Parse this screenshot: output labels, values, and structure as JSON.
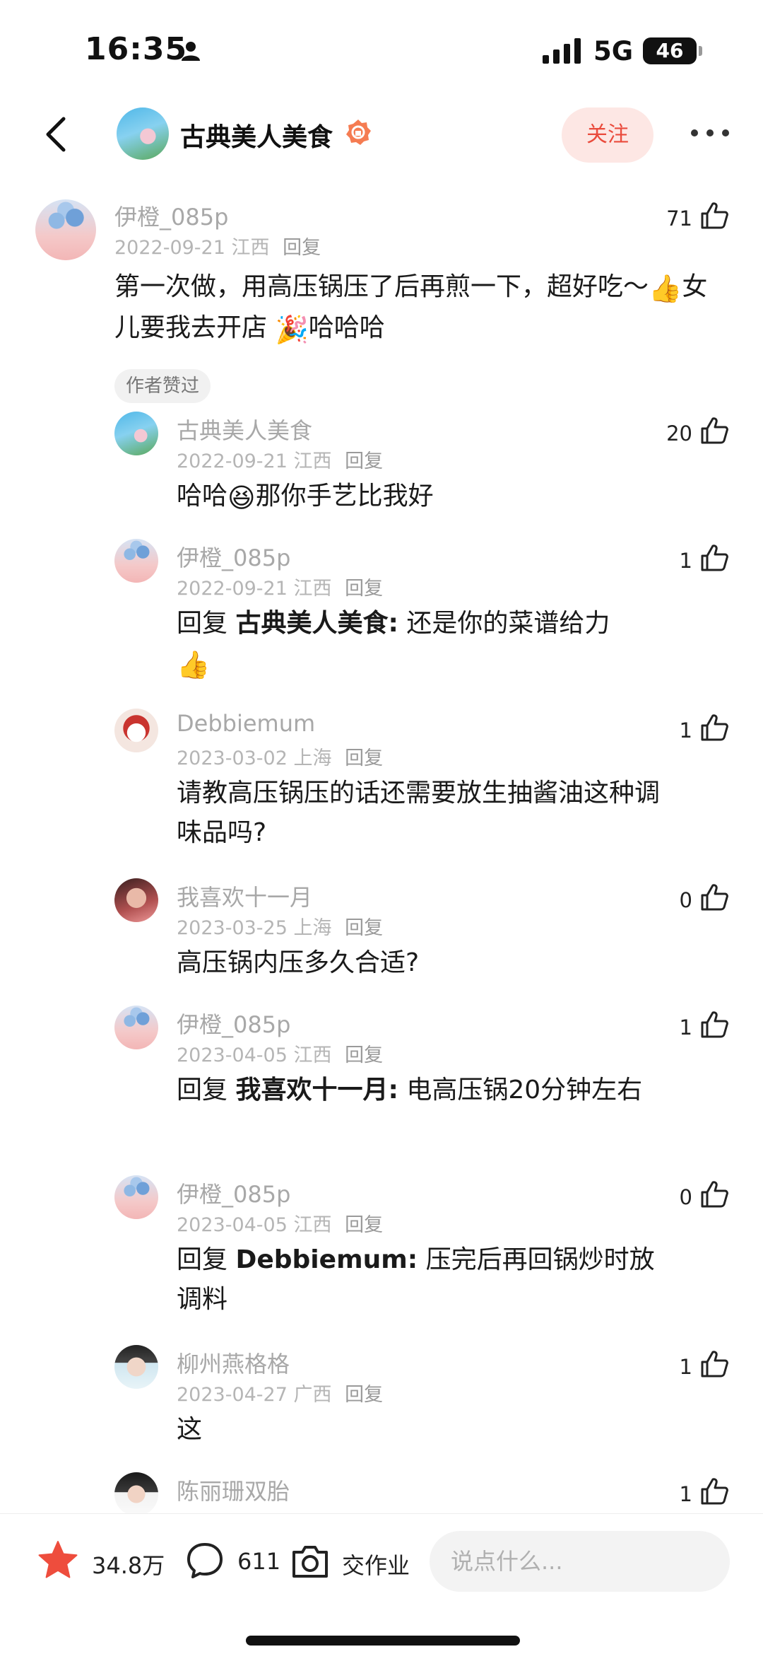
{
  "status_bar": {
    "time": "16:35",
    "network": "5G",
    "battery": "46"
  },
  "header": {
    "author_name": "古典美人美食",
    "follow_label": "关注"
  },
  "comments": [
    {
      "user": "伊橙_085p",
      "date": "2022-09-21",
      "location": "江西",
      "reply": "回复",
      "likes": "71",
      "text_before": "第一次做，用高压锅压了后再煎一下，超好吃～",
      "emoji1": "👍",
      "text_middle": "女儿要我去开店",
      "emoji2": "🎉",
      "text_after": "哈哈哈",
      "author_tag": "作者赞过"
    },
    {
      "user": "古典美人美食",
      "date": "2022-09-21",
      "location": "江西",
      "reply": "回复",
      "likes": "20",
      "text_before": "哈哈",
      "emoji1": "😆",
      "text_after": "那你手艺比我好"
    },
    {
      "user": "伊橙_085p",
      "date": "2022-09-21",
      "location": "江西",
      "reply": "回复",
      "likes": "1",
      "reply_prefix": "回复",
      "reply_to": "古典美人美食:",
      "text": "还是你的菜谱给力",
      "emoji1": "👍"
    },
    {
      "user": "Debbiemum",
      "date": "2023-03-02",
      "location": "上海",
      "reply": "回复",
      "likes": "1",
      "text": "请教高压锅压的话还需要放生抽酱油这种调味品吗?"
    },
    {
      "user": "我喜欢十一月",
      "date": "2023-03-25",
      "location": "上海",
      "reply": "回复",
      "likes": "0",
      "text": "高压锅内压多久合适?"
    },
    {
      "user": "伊橙_085p",
      "date": "2023-04-05",
      "location": "江西",
      "reply": "回复",
      "likes": "1",
      "reply_prefix": "回复",
      "reply_to": "我喜欢十一月:",
      "text": "电高压锅20分钟左右"
    },
    {
      "user": "伊橙_085p",
      "date": "2023-04-05",
      "location": "江西",
      "reply": "回复",
      "likes": "0",
      "reply_prefix": "回复",
      "reply_to": "Debbiemum:",
      "text": "压完后再回锅炒时放调料"
    },
    {
      "user": "柳州燕格格",
      "date": "2023-04-27",
      "location": "广西",
      "reply": "回复",
      "likes": "1",
      "text": "这"
    },
    {
      "user": "陈丽珊双胎",
      "likes": "1"
    }
  ],
  "bottom_bar": {
    "collect_count": "34.8万",
    "comment_count": "611",
    "homework_label": "交作业",
    "input_placeholder": "说点什么..."
  },
  "colors": {
    "accent": "#ea4b3c",
    "follow_bg": "#fde7e4",
    "meta_gray": "#b5b5b5"
  },
  "icons": [
    "person-icon",
    "signal-icon",
    "back-icon",
    "verified-badge-icon",
    "more-icon",
    "like-icon",
    "star-icon",
    "comment-icon",
    "camera-icon"
  ]
}
